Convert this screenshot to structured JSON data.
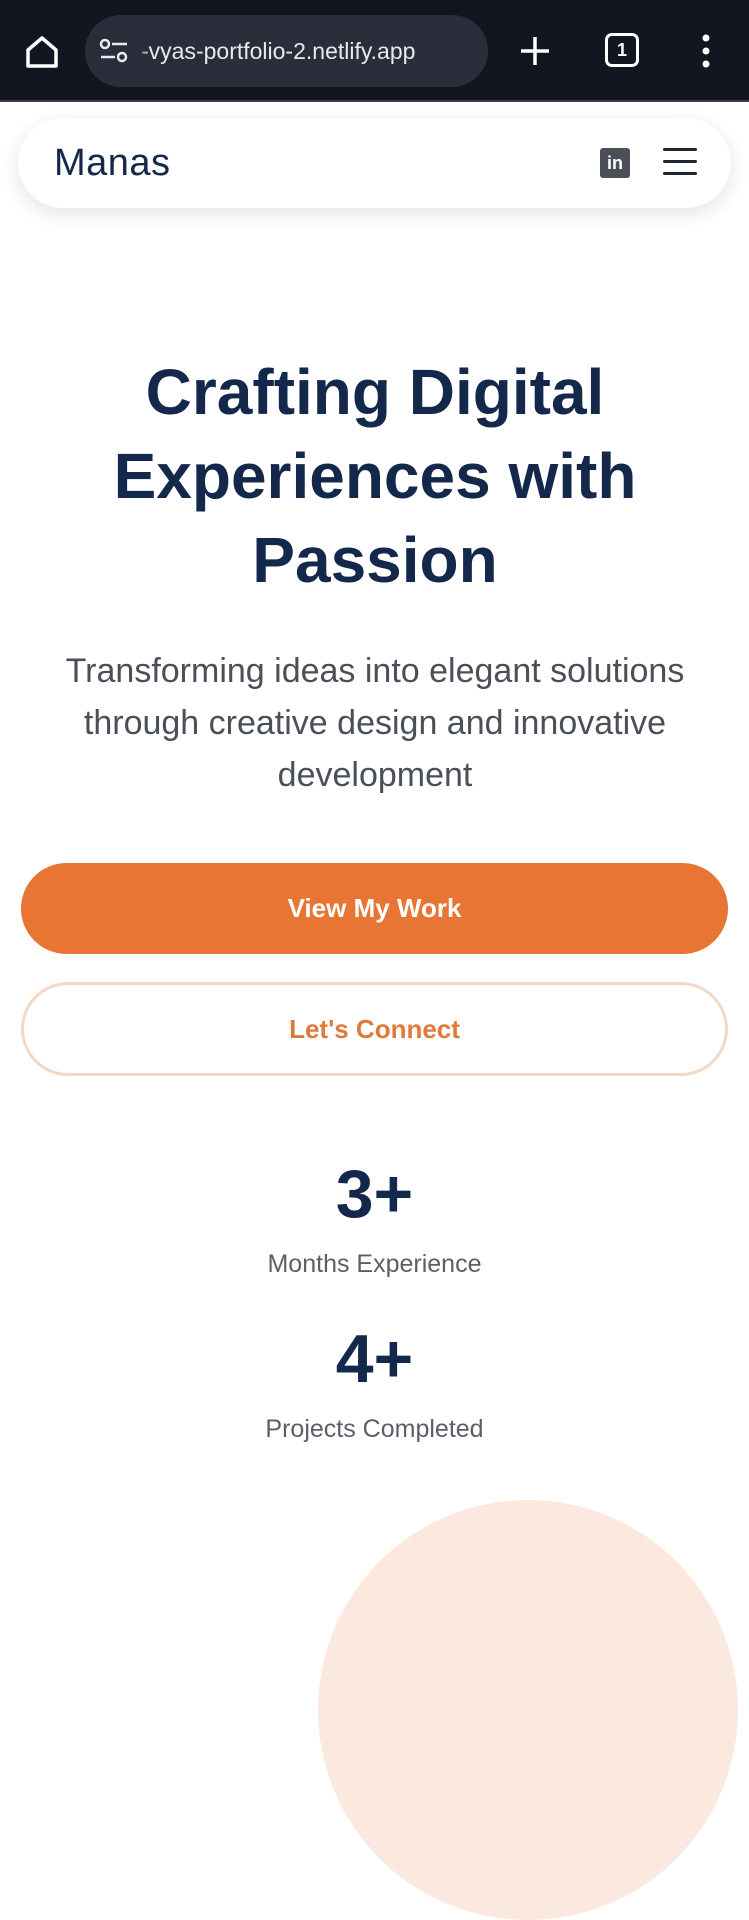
{
  "browser": {
    "url": "-vyas-portfolio-2.netlify.app",
    "tab_count": "1"
  },
  "nav": {
    "brand": "Manas",
    "linkedin_label": "in"
  },
  "hero": {
    "title": "Crafting Digital Experiences with Passion",
    "subtitle": "Transforming ideas into elegant solutions through creative design and innovative development",
    "primary_button": "View My Work",
    "secondary_button": "Let's Connect"
  },
  "stats": [
    {
      "value": "3+",
      "label": "Months Experience"
    },
    {
      "value": "4+",
      "label": "Projects Completed"
    }
  ],
  "colors": {
    "accent": "#e87533",
    "heading": "#14284b",
    "browser_bg": "#121620",
    "decor_circle": "#fbe9df"
  }
}
